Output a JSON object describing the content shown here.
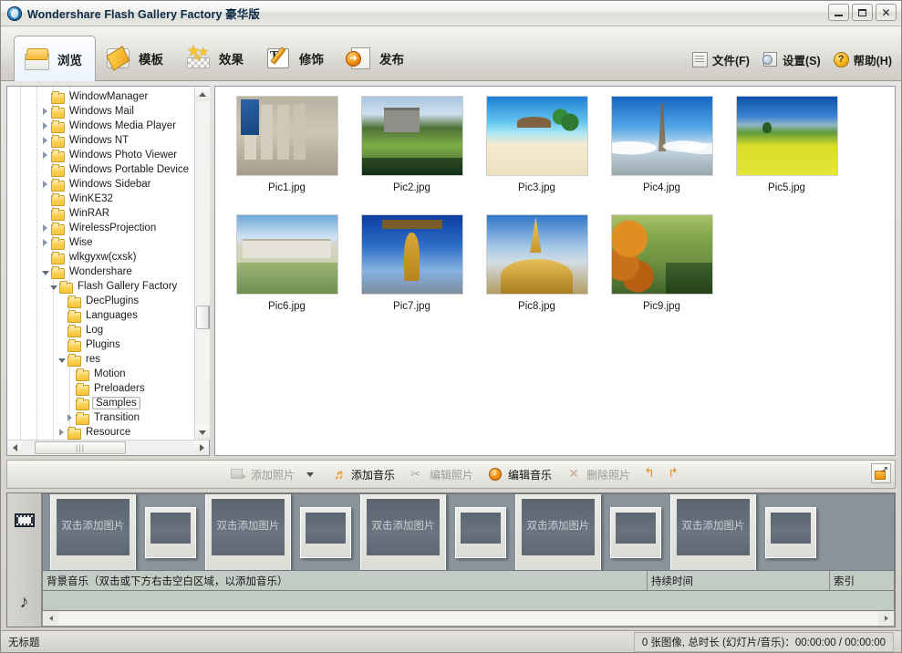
{
  "window": {
    "title": "Wondershare Flash Gallery Factory 豪华版",
    "app_icon": "wondershare-globe-icon",
    "buttons": {
      "minimize": "minimize-icon",
      "maximize": "maximize-icon",
      "close": "✕"
    }
  },
  "ribbon": {
    "tabs": [
      {
        "label": "浏览",
        "icon": "folder-icon",
        "active": true
      },
      {
        "label": "模板",
        "icon": "film-strip-icon",
        "active": false
      },
      {
        "label": "效果",
        "icon": "stars-icon",
        "active": false
      },
      {
        "label": "修饰",
        "icon": "text-pencil-icon",
        "active": false
      },
      {
        "label": "发布",
        "icon": "publish-arrow-icon",
        "active": false
      }
    ],
    "menus": [
      {
        "label": "文件(F)",
        "icon": "document-icon"
      },
      {
        "label": "设置(S)",
        "icon": "settings-icon"
      },
      {
        "label": "帮助(H)",
        "icon": "help-icon",
        "glyph": "?"
      }
    ]
  },
  "tree": {
    "nodes": [
      {
        "label": "WindowManager",
        "indent": 4,
        "expander": "none",
        "selected": false
      },
      {
        "label": "Windows Mail",
        "indent": 4,
        "expander": "collapsed",
        "selected": false
      },
      {
        "label": "Windows Media Player",
        "indent": 4,
        "expander": "collapsed",
        "selected": false
      },
      {
        "label": "Windows NT",
        "indent": 4,
        "expander": "collapsed",
        "selected": false
      },
      {
        "label": "Windows Photo Viewer",
        "indent": 4,
        "expander": "collapsed",
        "selected": false
      },
      {
        "label": "Windows Portable Device",
        "indent": 4,
        "expander": "none",
        "selected": false
      },
      {
        "label": "Windows Sidebar",
        "indent": 4,
        "expander": "collapsed",
        "selected": false
      },
      {
        "label": "WinKE32",
        "indent": 4,
        "expander": "none",
        "selected": false
      },
      {
        "label": "WinRAR",
        "indent": 4,
        "expander": "none",
        "selected": false
      },
      {
        "label": "WirelessProjection",
        "indent": 4,
        "expander": "collapsed",
        "selected": false
      },
      {
        "label": "Wise",
        "indent": 4,
        "expander": "collapsed",
        "selected": false
      },
      {
        "label": "wlkgyxw(cxsk)",
        "indent": 4,
        "expander": "none",
        "selected": false
      },
      {
        "label": "Wondershare",
        "indent": 4,
        "expander": "expanded",
        "selected": false
      },
      {
        "label": "Flash Gallery Factory",
        "indent": 5,
        "expander": "expanded",
        "selected": false
      },
      {
        "label": "DecPlugins",
        "indent": 6,
        "expander": "none",
        "selected": false
      },
      {
        "label": "Languages",
        "indent": 6,
        "expander": "none",
        "selected": false
      },
      {
        "label": "Log",
        "indent": 6,
        "expander": "none",
        "selected": false
      },
      {
        "label": "Plugins",
        "indent": 6,
        "expander": "none",
        "selected": false
      },
      {
        "label": "res",
        "indent": 6,
        "expander": "expanded",
        "selected": false
      },
      {
        "label": "Motion",
        "indent": 7,
        "expander": "none",
        "selected": false
      },
      {
        "label": "Preloaders",
        "indent": 7,
        "expander": "none",
        "selected": false
      },
      {
        "label": "Samples",
        "indent": 7,
        "expander": "none",
        "selected": true
      },
      {
        "label": "Transition",
        "indent": 7,
        "expander": "collapsed",
        "selected": false
      },
      {
        "label": "Resource",
        "indent": 6,
        "expander": "collapsed",
        "selected": false
      }
    ]
  },
  "thumbnails": [
    {
      "name": "Pic1.jpg",
      "art": "a1"
    },
    {
      "name": "Pic2.jpg",
      "art": "a2"
    },
    {
      "name": "Pic3.jpg",
      "art": "a3"
    },
    {
      "name": "Pic4.jpg",
      "art": "a4"
    },
    {
      "name": "Pic5.jpg",
      "art": "a5"
    },
    {
      "name": "Pic6.jpg",
      "art": "a6"
    },
    {
      "name": "Pic7.jpg",
      "art": "a7"
    },
    {
      "name": "Pic8.jpg",
      "art": "a8"
    },
    {
      "name": "Pic9.jpg",
      "art": "a9"
    }
  ],
  "midbar": {
    "add_photo": "添加照片",
    "add_music": "添加音乐",
    "edit_photo": "编辑照片",
    "edit_music": "编辑音乐",
    "delete_photo": "删除照片",
    "rotate_left": "rotate-left-icon",
    "rotate_right": "rotate-right-icon",
    "expand": "expand-icon"
  },
  "storyboard": {
    "film_icon": "film-strip-icon",
    "music_icon": "♪",
    "slide_placeholder": "双击添加图片",
    "slots": [
      "big",
      "small",
      "big",
      "small",
      "big",
      "small",
      "big",
      "small",
      "big",
      "small"
    ],
    "music_columns": {
      "name": "背景音乐（双击或下方右击空白区域，以添加音乐）",
      "duration": "持续时间",
      "index": "索引"
    }
  },
  "statusbar": {
    "left": "无标题",
    "right": "0 张图像, 总时长 (幻灯片/音乐)：00:00:00 / 00:00:00"
  }
}
